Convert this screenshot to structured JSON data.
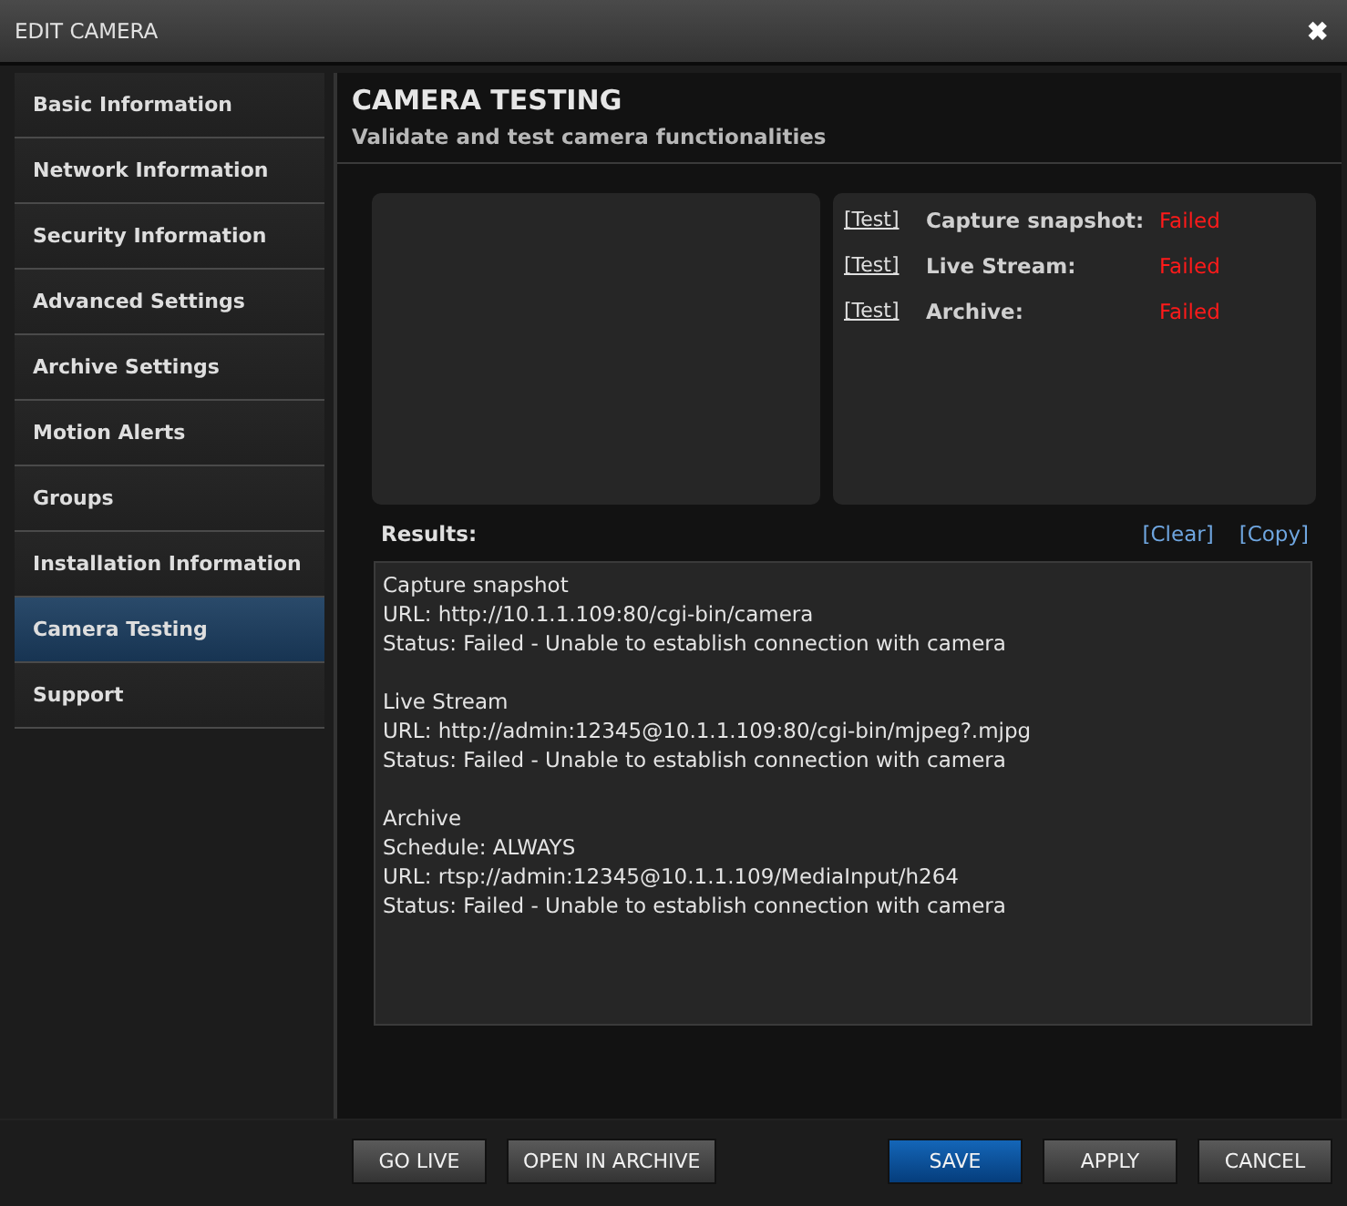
{
  "window": {
    "title": "EDIT CAMERA",
    "close": "✖"
  },
  "sidebar": {
    "items": [
      {
        "label": "Basic Information",
        "selected": false
      },
      {
        "label": "Network Information",
        "selected": false
      },
      {
        "label": "Security Information",
        "selected": false
      },
      {
        "label": "Advanced Settings",
        "selected": false
      },
      {
        "label": "Archive Settings",
        "selected": false
      },
      {
        "label": "Motion Alerts",
        "selected": false
      },
      {
        "label": "Groups",
        "selected": false
      },
      {
        "label": "Installation Information",
        "selected": false
      },
      {
        "label": "Camera Testing",
        "selected": true
      },
      {
        "label": "Support",
        "selected": false
      }
    ]
  },
  "header": {
    "title": "CAMERA TESTING",
    "subtitle": "Validate and test camera functionalities"
  },
  "tests": [
    {
      "action": "[Test]",
      "name": "Capture snapshot:",
      "status": "Failed",
      "kind": "failed"
    },
    {
      "action": "[Test]",
      "name": "Live Stream:",
      "status": "Failed",
      "kind": "failed"
    },
    {
      "action": "[Test]",
      "name": "Archive:",
      "status": "Failed",
      "kind": "failed"
    }
  ],
  "results": {
    "label": "Results:",
    "actions": [
      "[Clear]",
      "[Copy]"
    ],
    "groups": [
      [
        "Capture snapshot",
        "URL: http://10.1.1.109:80/cgi-bin/camera",
        "Status: Failed - Unable to establish connection with camera"
      ],
      [
        "Live Stream",
        "URL: http://admin:12345@10.1.1.109:80/cgi-bin/mjpeg?.mjpg",
        "Status: Failed - Unable to establish connection with camera"
      ],
      [
        "Archive",
        "Schedule: ALWAYS",
        "URL: rtsp://admin:12345@10.1.1.109/MediaInput/h264",
        "Status: Failed - Unable to establish connection with camera"
      ]
    ]
  },
  "footer": {
    "left_buttons": [
      {
        "label": "GO LIVE",
        "kind": "normal"
      },
      {
        "label": "OPEN IN ARCHIVE",
        "kind": "normal"
      }
    ],
    "right_buttons": [
      {
        "label": "SAVE",
        "kind": "primary"
      },
      {
        "label": "APPLY",
        "kind": "normal"
      },
      {
        "label": "CANCEL",
        "kind": "normal"
      }
    ]
  }
}
